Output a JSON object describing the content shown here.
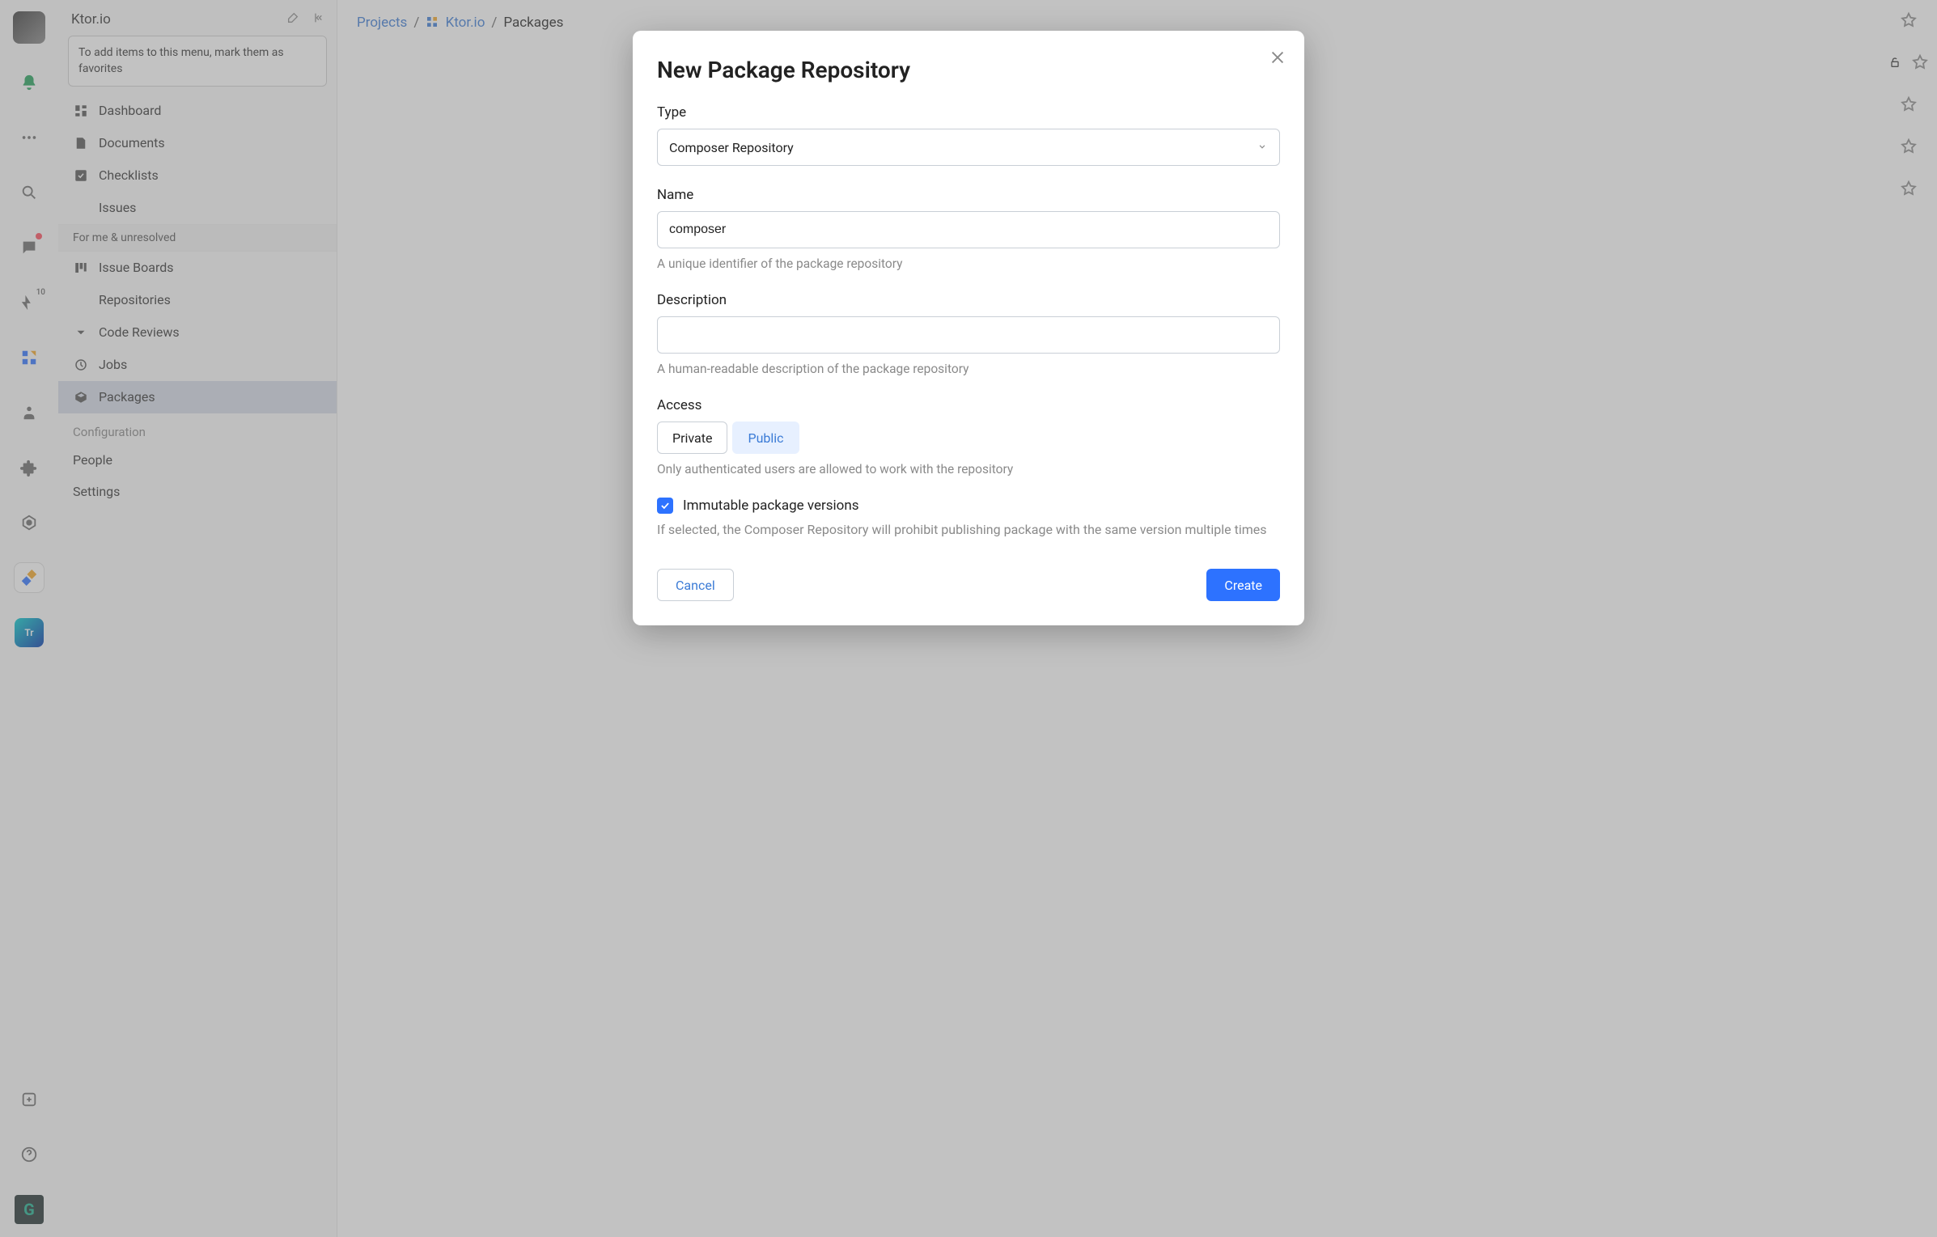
{
  "rail": {
    "bolt_badge": "10",
    "app2_label": "Tr",
    "appg_label": "G"
  },
  "sidebar": {
    "title": "Ktor.io",
    "banner": "To add items to this menu, mark them as favorites",
    "items": [
      {
        "label": "Dashboard"
      },
      {
        "label": "Documents"
      },
      {
        "label": "Checklists"
      },
      {
        "label": "Issues"
      },
      {
        "label": "Issue Boards"
      },
      {
        "label": "Repositories"
      },
      {
        "label": "Code Reviews"
      },
      {
        "label": "Jobs"
      },
      {
        "label": "Packages"
      }
    ],
    "issues_sub": "For me & unresolved",
    "section_label": "Configuration",
    "plain_items": [
      {
        "label": "People"
      },
      {
        "label": "Settings"
      }
    ]
  },
  "breadcrumbs": {
    "items": [
      {
        "label": "Projects",
        "link": true
      },
      {
        "label": "Ktor.io",
        "link": true,
        "icon": true
      },
      {
        "label": "Packages",
        "link": false
      }
    ]
  },
  "modal": {
    "title": "New Package Repository",
    "fields": {
      "type": {
        "label": "Type",
        "value": "Composer Repository"
      },
      "name": {
        "label": "Name",
        "value": "composer",
        "helper": "A unique identifier of the package repository"
      },
      "description": {
        "label": "Description",
        "value": "",
        "helper": "A human-readable description of the package repository"
      },
      "access": {
        "label": "Access",
        "private_label": "Private",
        "public_label": "Public",
        "helper": "Only authenticated users are allowed to work with the repository"
      },
      "immutable": {
        "label": "Immutable package versions",
        "checked": true,
        "helper": "If selected, the Composer Repository will prohibit publishing package with the same version multiple times"
      }
    },
    "actions": {
      "cancel": "Cancel",
      "create": "Create"
    }
  }
}
